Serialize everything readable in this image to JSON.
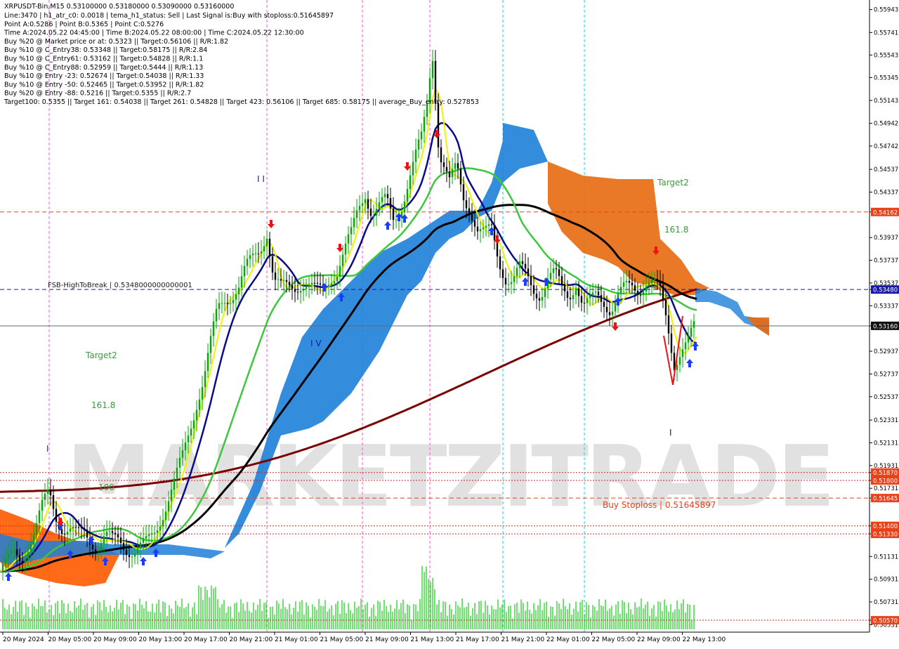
{
  "header": {
    "title_line": "XRPUSDT-Bin,M15  0.53100000 0.53180000 0.53090000 0.53160000",
    "info_lines": [
      "Line:3470  |  h1_atr_c0: 0.0018  |  tema_h1_status: Sell  |  Last Signal is:Buy with stoploss:0.51645897",
      "Point A:0.5286  |  Point B:0.5365  |  Point C:0.5276",
      "Time A:2024.05.22 04:45:00  |  Time B:2024.05.22 08:00:00  |  Time C:2024.05.22 12:30:00",
      "Buy %20 @ Market price or at: 0.5323  ||  Target:0.56106  ||  R/R:1.82",
      "Buy %10 @ C_Entry38: 0.53348  ||  Target:0.58175  ||  R/R:2.84",
      "Buy %10 @ C_Entry61: 0.53162  ||  Target:0.54828  ||  R/R:1.1",
      "Buy %10 @ C_Entry88: 0.52959  ||  Target:0.5444  ||  R/R:1.13",
      "Buy %10 @ Entry -23: 0.52674  ||  Target:0.54038  ||  R/R:1.33",
      "Buy %10 @ Entry -50: 0.52465  ||  Target:0.53952  ||  R/R:1.82",
      "Buy %20 @ Entry -88: 0.5216  ||  Target:0.5355  ||  R/R:2.7",
      "Target100: 0.5355  ||  Target 161: 0.54038  ||  Target 261: 0.54828  ||  Target 423: 0.56106  ||  Target 685: 0.58175  ||  average_Buy_entry: 0.527853"
    ]
  },
  "watermark": "MARKETZITRADE",
  "annotations": {
    "fsb_label": "FSB-HighToBreak  |  0.5348000000000001",
    "buy_stoploss": "Buy Stoploss | 0.51645897",
    "target2_right": "Target2",
    "fib161_right": "161.8",
    "target2_left": "Target2",
    "fib161_left": "161.8",
    "fib100_left": "100",
    "wave_I_top": "I I",
    "wave_IV": "I V",
    "wave_I_left": "I",
    "wave_I_right": "I"
  },
  "colors": {
    "background": "#ffffff",
    "bull_candle": "#00aa00",
    "bear_candle": "#000000",
    "cloud_blue": "#1e7fd8",
    "cloud_orange": "#e86a10",
    "cloud_left_orange": "#ff5a00",
    "ma_yellow": "#f5f000",
    "ma_navy": "#0a0a8c",
    "ma_green": "#3cc83c",
    "ma_black": "#000000",
    "ma_maroon": "#7a0000",
    "level_red": "#e8421a",
    "fsb_blue": "#1a1aa8",
    "current_price": "#5a6a78",
    "magenta_vline": "#ff55cc",
    "cyan_vline": "#00d8e8",
    "volume": "#00cc00",
    "arrow_up": "#1a3cff",
    "arrow_down": "#ee1111",
    "fib_text": "#3a9a3a"
  },
  "chart_data": {
    "type": "candlestick",
    "symbol": "XRPUSDT-Bin",
    "timeframe": "M15",
    "ohlc_last": {
      "open": 0.531,
      "high": 0.5318,
      "low": 0.5309,
      "close": 0.5316
    },
    "ylim": [
      0.5049,
      0.5599
    ],
    "y_ticks": [
      "0.55943",
      "0.55741",
      "0.55543",
      "0.55345",
      "0.55143",
      "0.54942",
      "0.54742",
      "0.54537",
      "0.54337",
      "0.54162",
      "0.53937",
      "0.53737",
      "0.53537",
      "0.53480",
      "0.53337",
      "0.53160",
      "0.52937",
      "0.52737",
      "0.52537",
      "0.52331",
      "0.52131",
      "0.51931",
      "0.51870",
      "0.51800",
      "0.51731",
      "0.51645",
      "0.51400",
      "0.51330",
      "0.51131",
      "0.50931",
      "0.50731",
      "0.50570",
      "0.50531"
    ],
    "x_labels": [
      "20 May 2024",
      "20 May 05:00",
      "20 May 09:00",
      "20 May 13:00",
      "20 May 17:00",
      "20 May 21:00",
      "21 May 01:00",
      "21 May 05:00",
      "21 May 09:00",
      "21 May 13:00",
      "21 May 17:00",
      "21 May 21:00",
      "22 May 01:00",
      "22 May 05:00",
      "22 May 09:00",
      "22 May 13:00"
    ],
    "price_levels": [
      {
        "label": "0.54162",
        "value": 0.54162,
        "style": "dashed",
        "color": "#e8421a"
      },
      {
        "label": "0.53480",
        "value": 0.5348,
        "style": "dashed",
        "color": "#1a1aa8"
      },
      {
        "label": "0.53160",
        "value": 0.5316,
        "style": "solid",
        "color": "#5a6a78"
      },
      {
        "label": "0.51870",
        "value": 0.5187,
        "style": "dotted",
        "color": "#c82828"
      },
      {
        "label": "0.51800",
        "value": 0.518,
        "style": "dotted",
        "color": "#c82828"
      },
      {
        "label": "0.51645",
        "value": 0.51645,
        "style": "dashed",
        "color": "#e8421a"
      },
      {
        "label": "0.51400",
        "value": 0.514,
        "style": "dotted",
        "color": "#c82828"
      },
      {
        "label": "0.51330",
        "value": 0.5133,
        "style": "dotted",
        "color": "#c82828"
      },
      {
        "label": "0.50570",
        "value": 0.5057,
        "style": "dotted",
        "color": "#c82828"
      }
    ],
    "price_path": [
      [
        0,
        0.51
      ],
      [
        10,
        0.5106
      ],
      [
        20,
        0.5115
      ],
      [
        30,
        0.5112
      ],
      [
        40,
        0.5124
      ],
      [
        50,
        0.5135
      ],
      [
        60,
        0.5155
      ],
      [
        70,
        0.517
      ],
      [
        80,
        0.515
      ],
      [
        90,
        0.5138
      ],
      [
        100,
        0.5135
      ],
      [
        110,
        0.513
      ],
      [
        120,
        0.5135
      ],
      [
        130,
        0.5128
      ],
      [
        140,
        0.5124
      ],
      [
        150,
        0.513
      ],
      [
        160,
        0.5126
      ],
      [
        170,
        0.5128
      ],
      [
        180,
        0.5122
      ],
      [
        190,
        0.5118
      ],
      [
        200,
        0.512
      ],
      [
        210,
        0.5124
      ],
      [
        220,
        0.5135
      ],
      [
        230,
        0.515
      ],
      [
        240,
        0.5165
      ],
      [
        250,
        0.518
      ],
      [
        260,
        0.52
      ],
      [
        270,
        0.5225
      ],
      [
        280,
        0.525
      ],
      [
        290,
        0.527
      ],
      [
        300,
        0.53
      ],
      [
        310,
        0.533
      ],
      [
        320,
        0.534
      ],
      [
        330,
        0.5345
      ],
      [
        340,
        0.535
      ],
      [
        350,
        0.5365
      ],
      [
        360,
        0.5375
      ],
      [
        370,
        0.5385
      ],
      [
        380,
        0.54
      ],
      [
        390,
        0.5355
      ],
      [
        400,
        0.5348
      ],
      [
        410,
        0.535
      ],
      [
        420,
        0.5352
      ],
      [
        430,
        0.5355
      ],
      [
        440,
        0.535
      ],
      [
        450,
        0.5345
      ],
      [
        460,
        0.5348
      ],
      [
        470,
        0.536
      ],
      [
        480,
        0.5365
      ],
      [
        490,
        0.538
      ],
      [
        500,
        0.5395
      ],
      [
        510,
        0.542
      ],
      [
        520,
        0.5435
      ],
      [
        530,
        0.5415
      ],
      [
        540,
        0.542
      ],
      [
        550,
        0.5425
      ],
      [
        560,
        0.541
      ],
      [
        570,
        0.542
      ],
      [
        580,
        0.544
      ],
      [
        590,
        0.546
      ],
      [
        600,
        0.548
      ],
      [
        610,
        0.552
      ],
      [
        615,
        0.5565
      ],
      [
        620,
        0.552
      ],
      [
        625,
        0.547
      ],
      [
        630,
        0.546
      ],
      [
        640,
        0.544
      ],
      [
        650,
        0.5455
      ],
      [
        660,
        0.543
      ],
      [
        670,
        0.542
      ],
      [
        680,
        0.54
      ],
      [
        690,
        0.5395
      ],
      [
        700,
        0.54
      ],
      [
        710,
        0.5375
      ],
      [
        720,
        0.536
      ],
      [
        730,
        0.5355
      ],
      [
        740,
        0.5365
      ],
      [
        750,
        0.536
      ],
      [
        760,
        0.535
      ],
      [
        770,
        0.5345
      ],
      [
        780,
        0.5355
      ],
      [
        790,
        0.536
      ],
      [
        800,
        0.535
      ],
      [
        810,
        0.5345
      ],
      [
        820,
        0.5355
      ],
      [
        830,
        0.533
      ],
      [
        840,
        0.5335
      ],
      [
        850,
        0.5345
      ],
      [
        860,
        0.534
      ],
      [
        870,
        0.533
      ],
      [
        880,
        0.534
      ],
      [
        890,
        0.5348
      ],
      [
        900,
        0.5352
      ],
      [
        910,
        0.535
      ],
      [
        920,
        0.5355
      ],
      [
        930,
        0.5352
      ],
      [
        940,
        0.5345
      ],
      [
        950,
        0.532
      ],
      [
        960,
        0.5285
      ],
      [
        970,
        0.5295
      ],
      [
        980,
        0.53
      ],
      [
        990,
        0.5316
      ]
    ],
    "volume_scale": 1
  }
}
